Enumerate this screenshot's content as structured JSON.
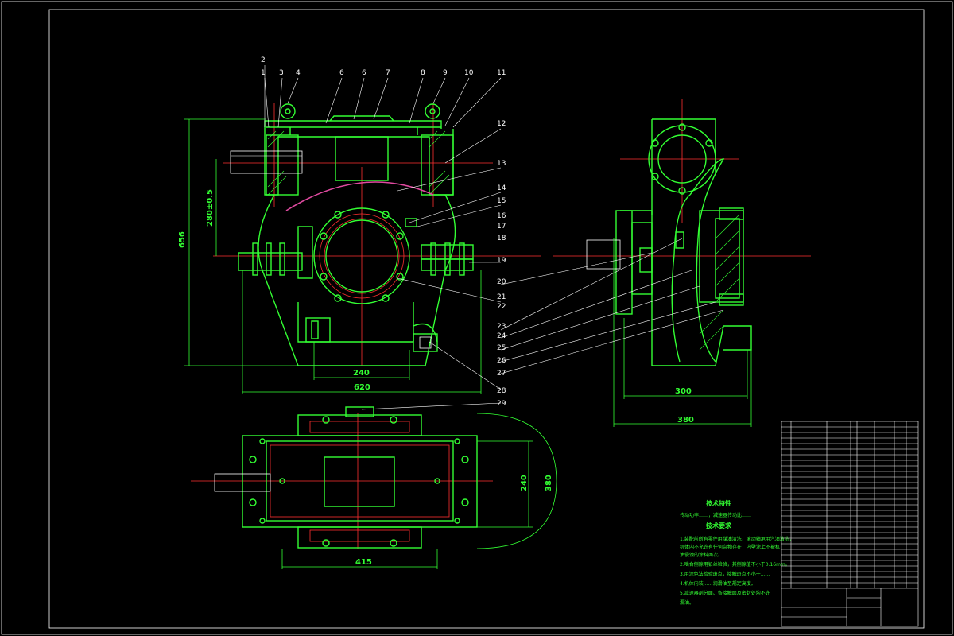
{
  "part_numbers": [
    "2",
    "1",
    "3",
    "4",
    "6",
    "6",
    "7",
    "8",
    "9",
    "10",
    "11",
    "12",
    "13",
    "14",
    "15",
    "16",
    "17",
    "18",
    "19",
    "20",
    "21",
    "22",
    "23",
    "24",
    "25",
    "26",
    "27",
    "28",
    "29"
  ],
  "dimensions": {
    "front_height": "656",
    "center_height": "280±0.5",
    "front_base_inner": "240",
    "front_base_outer": "620",
    "side_base_inner": "300",
    "side_base_outer": "380",
    "top_width": "415",
    "top_depth_inner": "240",
    "top_depth_outer": "380"
  },
  "technical": {
    "char_title": "技术特性",
    "char_text": "传动功率……，减速器传动比……",
    "req_title": "技术要求",
    "items": [
      "1.装配前所有零件用煤油清洗，滚动轴承用汽油清洗，",
      "机体内不允许有任何杂物存在，内壁涂上不被机",
      "油侵蚀的涂料两次。",
      "2.啮合侧隙用铅丝检验，其侧隙值不小于0.16mm。",
      "3.用涂色法检验斑点，接触斑点不小于……",
      "4.机体内装……润滑油至规定高度。",
      "5.减速器剖分面、各接触面及密封处均不许",
      "漏油。"
    ]
  }
}
